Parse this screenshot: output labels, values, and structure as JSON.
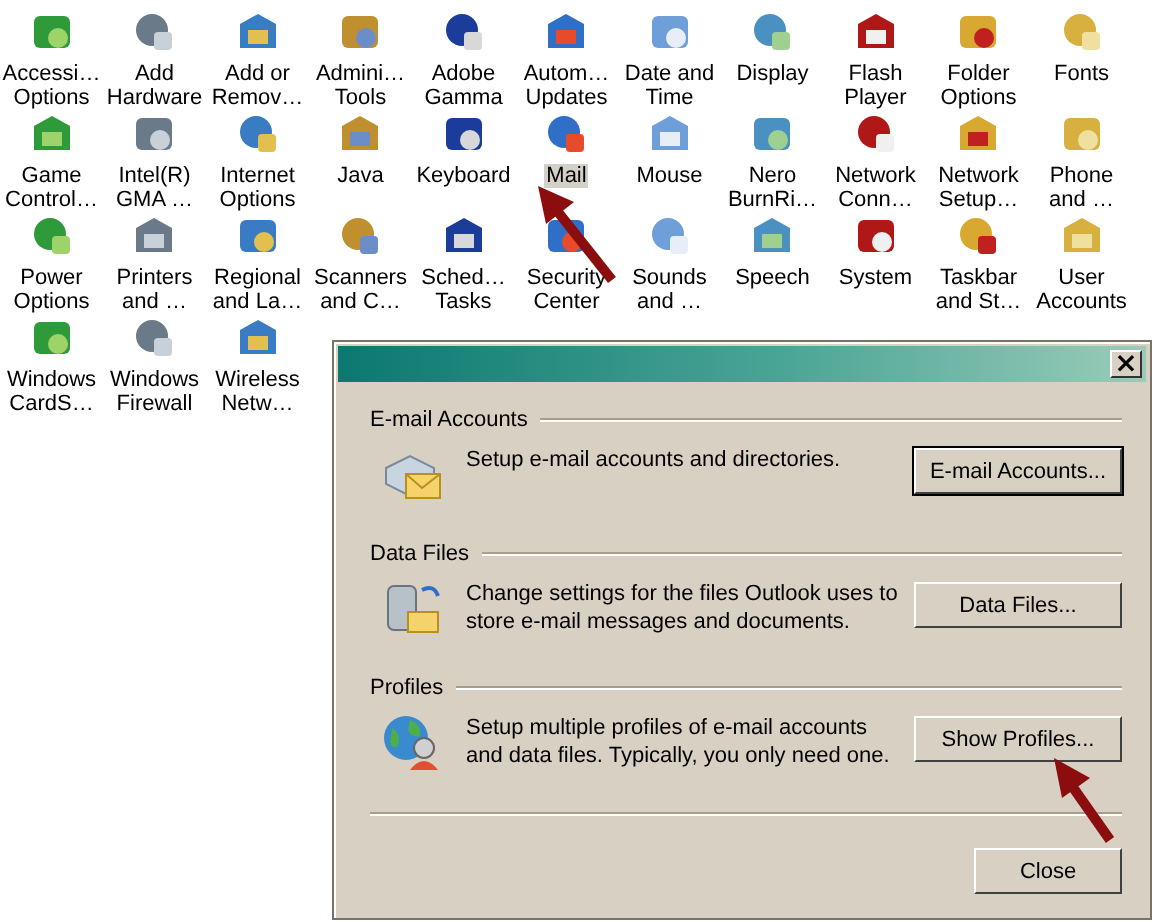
{
  "control_panel": {
    "items": [
      {
        "label": "Accessi…\nOptions",
        "selected": false
      },
      {
        "label": "Add\nHardware",
        "selected": false
      },
      {
        "label": "Add or\nRemov…",
        "selected": false
      },
      {
        "label": "Admini…\nTools",
        "selected": false
      },
      {
        "label": "Adobe\nGamma",
        "selected": false
      },
      {
        "label": "Autom…\nUpdates",
        "selected": false
      },
      {
        "label": "Date and\nTime",
        "selected": false
      },
      {
        "label": "Display",
        "selected": false
      },
      {
        "label": "Flash\nPlayer",
        "selected": false
      },
      {
        "label": "Folder\nOptions",
        "selected": false
      },
      {
        "label": "Fonts",
        "selected": false
      },
      {
        "label": "Game\nControl…",
        "selected": false
      },
      {
        "label": "Intel(R)\nGMA …",
        "selected": false
      },
      {
        "label": "Internet\nOptions",
        "selected": false
      },
      {
        "label": "Java",
        "selected": false
      },
      {
        "label": "Keyboard",
        "selected": false
      },
      {
        "label": "Mail",
        "selected": true
      },
      {
        "label": "Mouse",
        "selected": false
      },
      {
        "label": "Nero\nBurnRi…",
        "selected": false
      },
      {
        "label": "Network\nConn…",
        "selected": false
      },
      {
        "label": "Network\nSetup…",
        "selected": false
      },
      {
        "label": "Phone\nand …",
        "selected": false
      },
      {
        "label": "Power\nOptions",
        "selected": false
      },
      {
        "label": "Printers\nand …",
        "selected": false
      },
      {
        "label": "Regional\nand La…",
        "selected": false
      },
      {
        "label": "Scanners\nand C…",
        "selected": false
      },
      {
        "label": "Sched…\nTasks",
        "selected": false
      },
      {
        "label": "Security\nCenter",
        "selected": false
      },
      {
        "label": "Sounds\nand …",
        "selected": false
      },
      {
        "label": "Speech",
        "selected": false
      },
      {
        "label": "System",
        "selected": false
      },
      {
        "label": "Taskbar\nand St…",
        "selected": false
      },
      {
        "label": "User\nAccounts",
        "selected": false
      },
      {
        "label": "Windows\nCardS…",
        "selected": false
      },
      {
        "label": "Windows\nFirewall",
        "selected": false
      },
      {
        "label": "Wireless\nNetw…",
        "selected": false
      }
    ]
  },
  "mail_dialog": {
    "close_glyph": "×",
    "sections": [
      {
        "title": "E-mail Accounts",
        "description": "Setup e-mail accounts and directories.",
        "button": "E-mail Accounts...",
        "default": true
      },
      {
        "title": "Data Files",
        "description": "Change settings for the files Outlook uses to store e-mail messages and documents.",
        "button": "Data Files...",
        "default": false
      },
      {
        "title": "Profiles",
        "description": "Setup multiple profiles of e-mail accounts and data files. Typically, you only need one.",
        "button": "Show Profiles...",
        "default": false
      }
    ],
    "close_button": "Close"
  }
}
